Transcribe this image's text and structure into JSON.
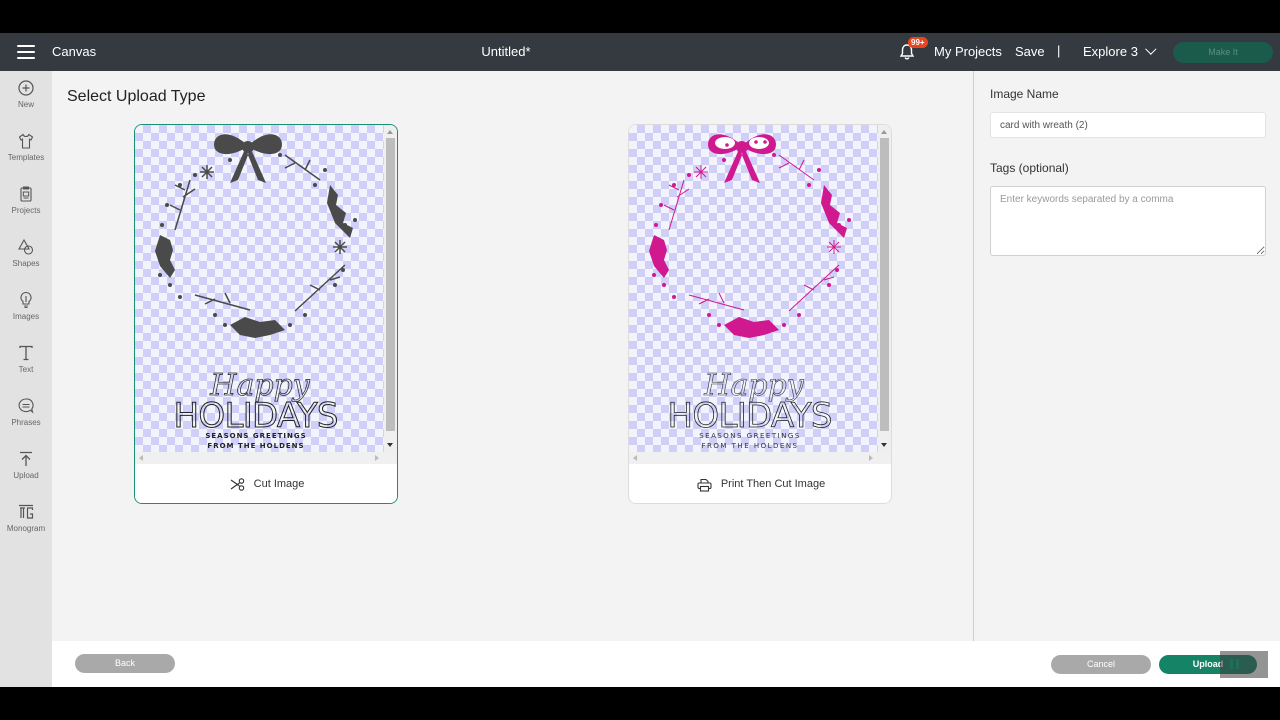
{
  "header": {
    "menu_icon": "hamburger-menu-icon",
    "section_label": "Canvas",
    "document_title": "Untitled*",
    "notification_badge": "99+",
    "my_projects_label": "My Projects",
    "save_label": "Save",
    "separator": "|",
    "machine_label": "Explore 3",
    "make_it_label": "Make It"
  },
  "sidebar": {
    "items": [
      {
        "label": "New",
        "icon": "plus-circle-icon"
      },
      {
        "label": "Templates",
        "icon": "shirt-icon"
      },
      {
        "label": "Projects",
        "icon": "projects-icon"
      },
      {
        "label": "Shapes",
        "icon": "shapes-icon"
      },
      {
        "label": "Images",
        "icon": "lightbulb-icon"
      },
      {
        "label": "Text",
        "icon": "text-icon"
      },
      {
        "label": "Phrases",
        "icon": "speech-bubble-icon"
      },
      {
        "label": "Upload",
        "icon": "upload-icon"
      },
      {
        "label": "Monogram",
        "icon": "monogram-icon"
      }
    ]
  },
  "main": {
    "title": "Select Upload Type",
    "options": [
      {
        "label": "Cut Image",
        "icon": "scissors-icon",
        "selected": true,
        "preview": {
          "color": "#4a4a4a",
          "script_text": "Happy",
          "headline": "HOLIDAYS",
          "line1": "SEASONS GREETINGS",
          "line2": "FROM THE HOLDENS"
        }
      },
      {
        "label": "Print Then Cut Image",
        "icon": "printer-icon",
        "selected": false,
        "preview": {
          "color": "#d0198f",
          "script_text": "Happy",
          "headline": "HOLIDAYS",
          "line1": "SEASONS GREETINGS",
          "line2": "FROM THE HOLDENS"
        }
      }
    ]
  },
  "panel": {
    "image_name_label": "Image Name",
    "image_name_value": "card with wreath (2)",
    "tags_label": "Tags (optional)",
    "tags_placeholder": "Enter keywords separated by a comma"
  },
  "footer": {
    "back_label": "Back",
    "cancel_label": "Cancel",
    "upload_label": "Upload"
  },
  "colors": {
    "topbar": "#353a40",
    "accent": "#158466",
    "selected_border": "#1a8f74",
    "badge": "#e8451e",
    "pink": "#d0198f"
  }
}
